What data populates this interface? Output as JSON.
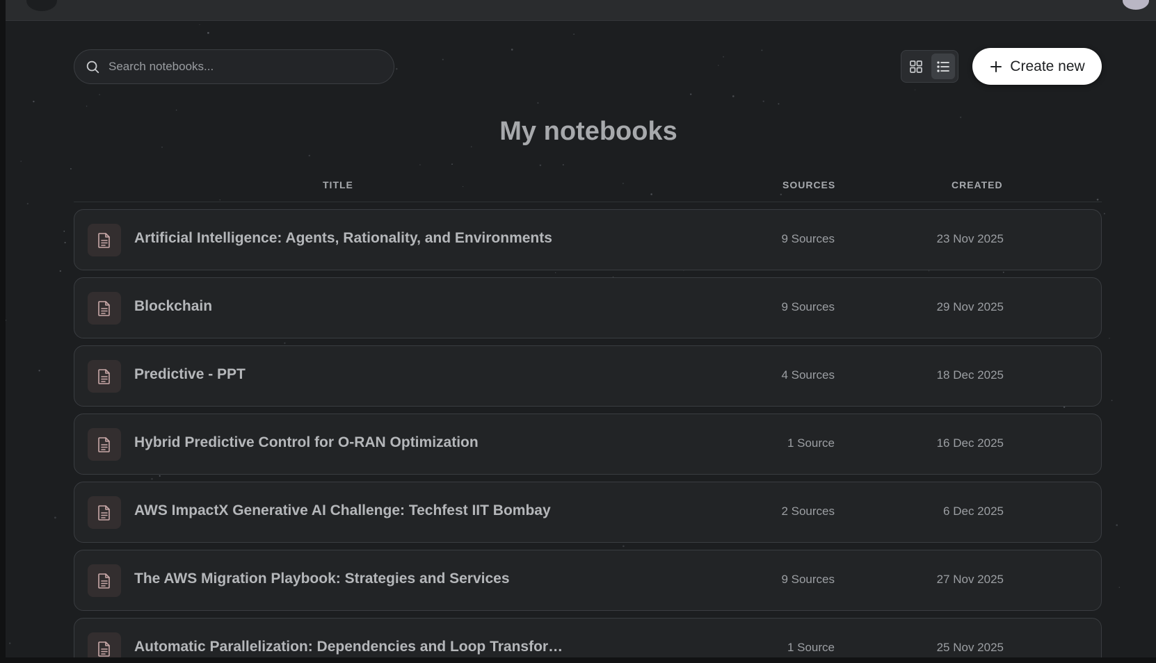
{
  "search": {
    "placeholder": "Search notebooks..."
  },
  "toolbar": {
    "grid_icon": "grid-icon",
    "list_icon": "list-icon",
    "create_label": "Create new",
    "create_icon": "plus-icon"
  },
  "page": {
    "title": "My notebooks"
  },
  "table": {
    "headers": {
      "title": "TITLE",
      "sources": "SOURCES",
      "created": "CREATED"
    },
    "rows": [
      {
        "title": "Artificial Intelligence: Agents, Rationality, and Environments",
        "sources": "9 Sources",
        "created": "23 Nov 2025"
      },
      {
        "title": "Blockchain",
        "sources": "9 Sources",
        "created": "29 Nov 2025"
      },
      {
        "title": "Predictive - PPT",
        "sources": "4 Sources",
        "created": "18 Dec 2025"
      },
      {
        "title": "Hybrid Predictive Control for O-RAN Optimization",
        "sources": "1 Source",
        "created": "16 Dec 2025"
      },
      {
        "title": "AWS ImpactX Generative AI Challenge: Techfest IIT Bombay",
        "sources": "2 Sources",
        "created": "6 Dec 2025"
      },
      {
        "title": "The AWS Migration Playbook: Strategies and Services",
        "sources": "9 Sources",
        "created": "27 Nov 2025"
      },
      {
        "title": "Automatic Parallelization: Dependencies and Loop Transformati...",
        "sources": "1 Source",
        "created": "25 Nov 2025"
      }
    ]
  },
  "colors": {
    "background": "#1c1e20",
    "row_background": "#222426",
    "row_border": "#3a3d41",
    "accent_icon": "#c9a9a9",
    "create_button": "#ffffff"
  }
}
